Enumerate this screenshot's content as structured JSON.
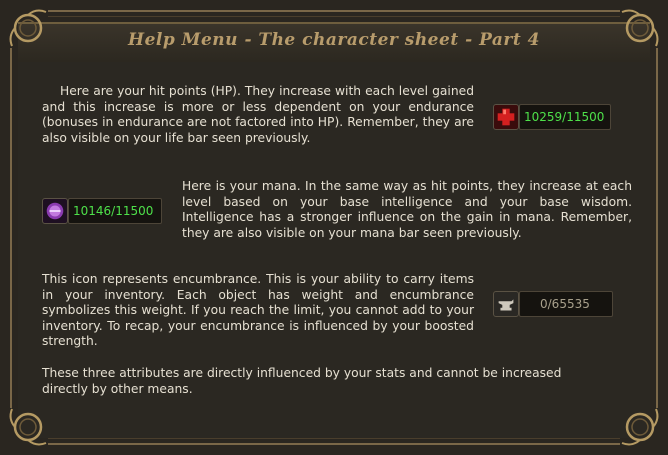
{
  "title": "Help Menu - The character sheet - Part 4",
  "paragraphs": {
    "hp": "Here are your hit points (HP). They increase with each level gained and this increase is more or less dependent on your endurance (bonuses in endurance are not factored into HP). Remember, they are also visible on your life bar seen previously.",
    "mana": "Here is your mana. In the same way as hit points, they increase at each level based on your base intelligence and your base wisdom. Intelligence has a stronger influence on the gain in mana. Remember, they are also visible on your mana bar seen previously.",
    "encumbrance": "This icon represents encumbrance. This is your ability to carry items in your inventory. Each object has  weight and encumbrance symbolizes this weight. If you reach the limit, you cannot add to your inventory. To recap, your encumbrance is influenced by your boosted strength.",
    "footer": "These three attributes are directly influenced by your stats and cannot be increased directly by other means."
  },
  "stats": {
    "hp": {
      "value": "10259/11500",
      "icon": "red-cross-icon",
      "color": "#4ee04a"
    },
    "mana": {
      "value": "10146/11500",
      "icon": "purple-orb-icon",
      "color": "#4ee04a"
    },
    "encumbrance": {
      "value": "0/65535",
      "icon": "anvil-icon",
      "color": "#a8a08c"
    }
  },
  "colors": {
    "title": "#b89c6c",
    "text": "#e6e0d2",
    "panel": "#2b2822",
    "frame_gold": "#7a6748"
  }
}
